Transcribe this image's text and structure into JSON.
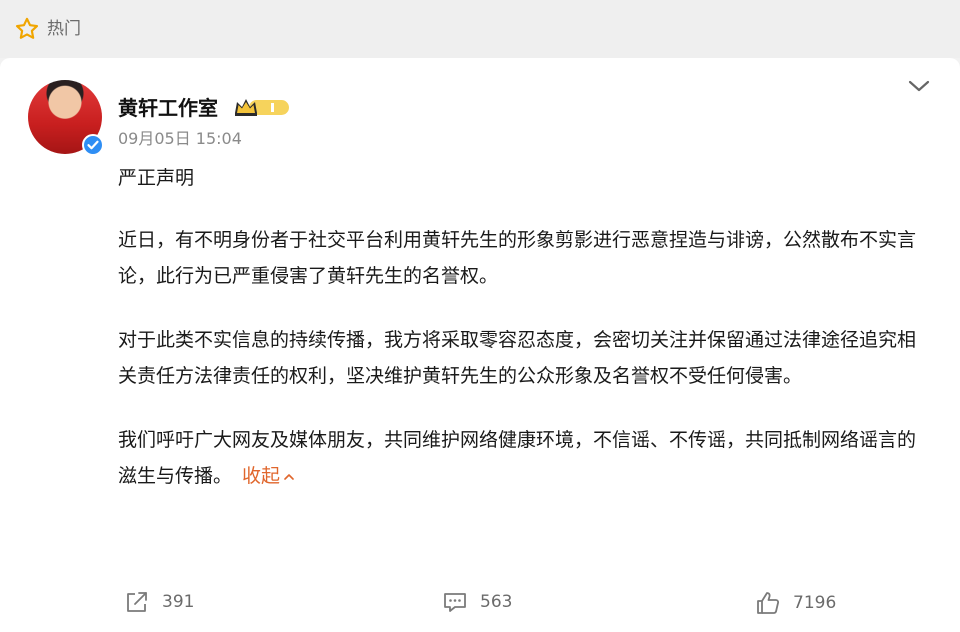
{
  "header": {
    "hot_label": "热门",
    "hot_icon": "star-outline-icon"
  },
  "post": {
    "author": "黄轩工作室",
    "verified_icon": "verified-check-icon",
    "vip_badge_icon": "crown-vip-badge-icon",
    "time": "09月05日 15:04",
    "title": "严正声明",
    "paragraphs": [
      "近日，有不明身份者于社交平台利用黄轩先生的形象剪影进行恶意捏造与诽谤，公然散布不实言论，此行为已严重侵害了黄轩先生的名誉权。",
      "对于此类不实信息的持续传播，我方将采取零容忍态度，会密切关注并保留通过法律途径追究相关责任方法律责任的权利，坚决维护黄轩先生的公众形象及名誉权不受任何侵害。",
      "我们呼吁广大网友及媒体朋友，共同维护网络健康环境，不信谣、不传谣，共同抵制网络谣言的滋生与传播。"
    ],
    "collapse_label": "收起"
  },
  "actions": {
    "share_count": "391",
    "comment_count": "563",
    "like_count": "7196"
  },
  "colors": {
    "link": "#e0662c",
    "verified": "#2f8ef4",
    "vip": "#e9b52e"
  }
}
